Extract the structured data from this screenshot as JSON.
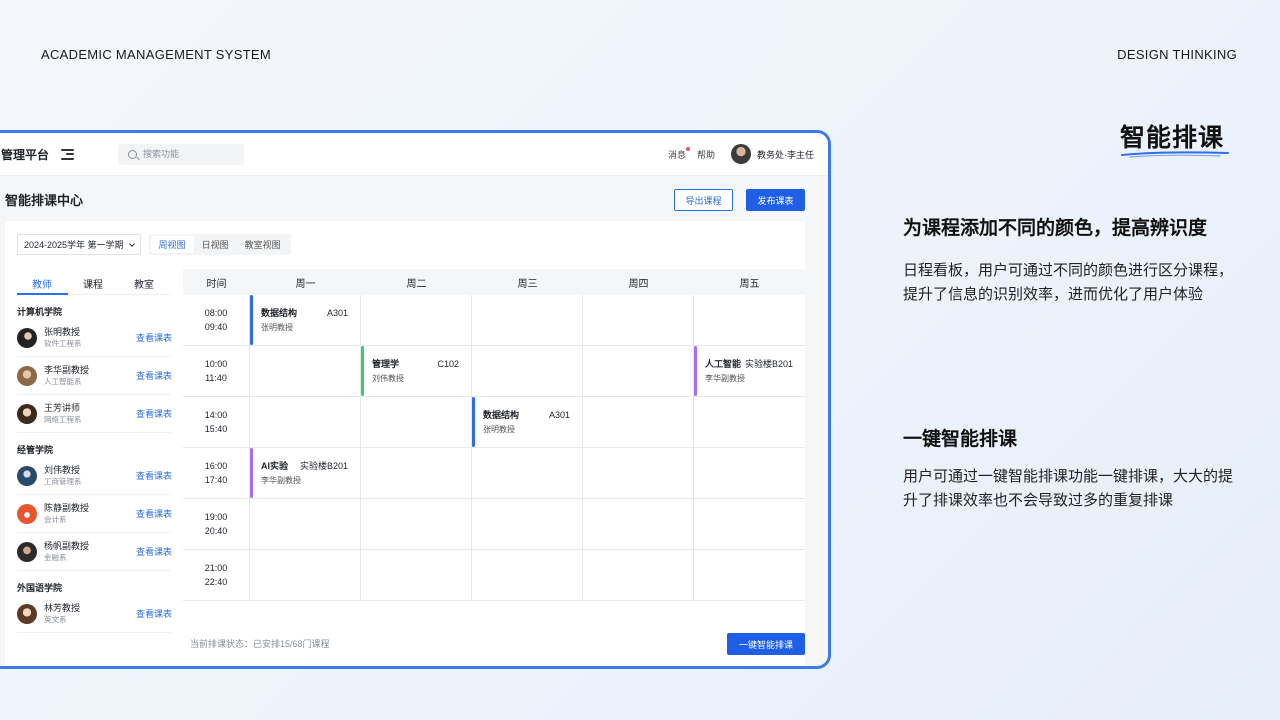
{
  "header": {
    "left_label": "ACADEMIC MANAGEMENT SYSTEM",
    "right_label": "DESIGN THINKING"
  },
  "colors": {
    "accent": "#2f6ee8",
    "frame": "#3f7be6",
    "course_blue": "#2f6ee8",
    "course_green": "#3ecb6c",
    "course_purple": "#a66ef2"
  },
  "app": {
    "logo": "管理平台",
    "menu_icon": "menu-fold-icon",
    "search_placeholder": "搜索功能",
    "messages": "消息",
    "help": "帮助",
    "user": "教务处·李主任",
    "page_title": "智能排课中心",
    "export_btn": "导出课程",
    "publish_btn": "发布课表",
    "term": "2024-2025学年 第一学期",
    "view_tabs": [
      "周视图",
      "日视图",
      "教室视图"
    ],
    "side_tabs": [
      "教师",
      "课程",
      "教室"
    ],
    "view_link": "查看课表",
    "departments": [
      {
        "name": "计算机学院",
        "teachers": [
          {
            "name": "张明教授",
            "major": "软件工程系"
          },
          {
            "name": "李华副教授",
            "major": "人工智能系"
          },
          {
            "name": "王芳讲师",
            "major": "网络工程系"
          }
        ]
      },
      {
        "name": "经管学院",
        "teachers": [
          {
            "name": "刘伟教授",
            "major": "工商管理系"
          },
          {
            "name": "陈静副教授",
            "major": "会计系"
          },
          {
            "name": "杨帆副教授",
            "major": "金融系"
          }
        ]
      },
      {
        "name": "外国语学院",
        "teachers": [
          {
            "name": "林芳教授",
            "major": "英文系"
          }
        ]
      }
    ],
    "grid_headers": [
      "时间",
      "周一",
      "周二",
      "周三",
      "周四",
      "周五"
    ],
    "time_slots": [
      {
        "start": "08:00",
        "end": "09:40"
      },
      {
        "start": "10:00",
        "end": "11:40"
      },
      {
        "start": "14:00",
        "end": "15:40"
      },
      {
        "start": "16:00",
        "end": "17:40"
      },
      {
        "start": "19:00",
        "end": "20:40"
      },
      {
        "start": "21:00",
        "end": "22:40"
      }
    ],
    "courses": [
      {
        "row": 0,
        "col": 0,
        "name": "数据结构",
        "room": "A301",
        "teacher": "张明教授",
        "color": "blue"
      },
      {
        "row": 1,
        "col": 1,
        "name": "管理学",
        "room": "C102",
        "teacher": "刘伟教授",
        "color": "green"
      },
      {
        "row": 1,
        "col": 4,
        "name": "人工智能",
        "room": "实验楼B201",
        "teacher": "李华副教授",
        "color": "purple"
      },
      {
        "row": 2,
        "col": 2,
        "name": "数据结构",
        "room": "A301",
        "teacher": "张明教授",
        "color": "blue"
      },
      {
        "row": 3,
        "col": 0,
        "name": "AI实验",
        "room": "实验楼B201",
        "teacher": "李华副教授",
        "color": "purple"
      }
    ],
    "status": "当前排课状态：已安排15/68门课程",
    "smart_btn": "一键智能排课"
  },
  "feature": {
    "title": "智能排课",
    "section1_title": "为课程添加不同的颜色，提高辨识度",
    "section1_text": "日程看板，用户可通过不同的颜色进行区分课程，提升了信息的识别效率，进而优化了用户体验",
    "section2_title": "一键智能排课",
    "section2_text": "用户可通过一键智能排课功能一键排课，大大的提升了排课效率也不会导致过多的重复排课"
  }
}
